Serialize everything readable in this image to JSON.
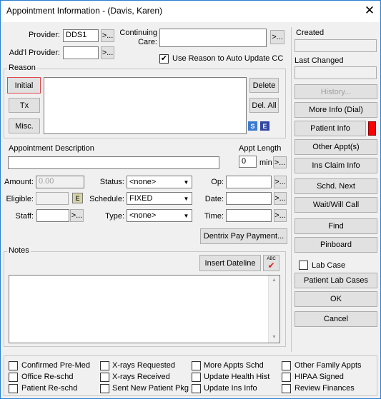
{
  "window": {
    "title": "Appointment Information - (Davis, Karen)",
    "close_glyph": "✕"
  },
  "provider": {
    "label": "Provider:",
    "value": "DDS1",
    "lookup": ">..."
  },
  "addl_provider": {
    "label": "Add'l Provider:",
    "value": "",
    "lookup": ">..."
  },
  "continuing_care": {
    "label_1": "Continuing",
    "label_2": "Care:",
    "value": "",
    "lookup": ">..."
  },
  "use_reason": {
    "label": "Use Reason to Auto Update CC",
    "checked": true,
    "mark": "✔"
  },
  "reason": {
    "legend": "Reason",
    "initial": "Initial",
    "tx": "Tx",
    "misc": "Misc.",
    "delete": "Delete",
    "del_all": "Del. All",
    "icon_s": "S",
    "icon_e": "E"
  },
  "appt_description": {
    "label": "Appointment Description",
    "value": ""
  },
  "appt_length": {
    "label": "Appt Length",
    "value": "0",
    "unit": "min",
    "lookup": ">..."
  },
  "amount": {
    "label": "Amount:",
    "value": "0.00"
  },
  "eligible": {
    "label": "Eligible:",
    "value": "",
    "icon": "E"
  },
  "staff": {
    "label": "Staff:",
    "value": "",
    "lookup": ">..."
  },
  "status": {
    "label": "Status:",
    "value": "<none>"
  },
  "schedule": {
    "label": "Schedule:",
    "value": "FIXED"
  },
  "type": {
    "label": "Type:",
    "value": "<none>"
  },
  "op": {
    "label": "Op:",
    "value": "",
    "lookup": ">..."
  },
  "date": {
    "label": "Date:",
    "value": "",
    "lookup": ">..."
  },
  "time": {
    "label": "Time:",
    "value": "",
    "lookup": ">..."
  },
  "dentrix_pay": "Dentrix Pay Payment...",
  "notes": {
    "legend": "Notes",
    "insert_dateline": "Insert Dateline",
    "spell_check": "ABC",
    "value": ""
  },
  "right_panel": {
    "created_label": "Created",
    "created_value": "",
    "last_changed_label": "Last Changed",
    "last_changed_value": "",
    "history": "History...",
    "more_info": "More Info (Dial)",
    "patient_info": "Patient Info",
    "patient_info_flag_color": "#ff0000",
    "other_appts": "Other Appt(s)",
    "ins_claim_info": "Ins Claim Info",
    "schd_next": "Schd. Next",
    "wait_will_call": "Wait/Will Call",
    "find": "Find",
    "pinboard": "Pinboard",
    "lab_case": "Lab Case",
    "patient_lab_cases": "Patient Lab Cases",
    "ok": "OK",
    "cancel": "Cancel"
  },
  "flags": [
    [
      "Confirmed Pre-Med",
      "X-rays Requested",
      "More Appts Schd",
      "Other Family Appts"
    ],
    [
      "Office Re-schd",
      "X-rays Received",
      "Update Health Hist",
      "HIPAA Signed"
    ],
    [
      "Patient Re-schd",
      "Sent New Patient Pkg",
      "Update Ins Info",
      "Review Finances"
    ]
  ]
}
